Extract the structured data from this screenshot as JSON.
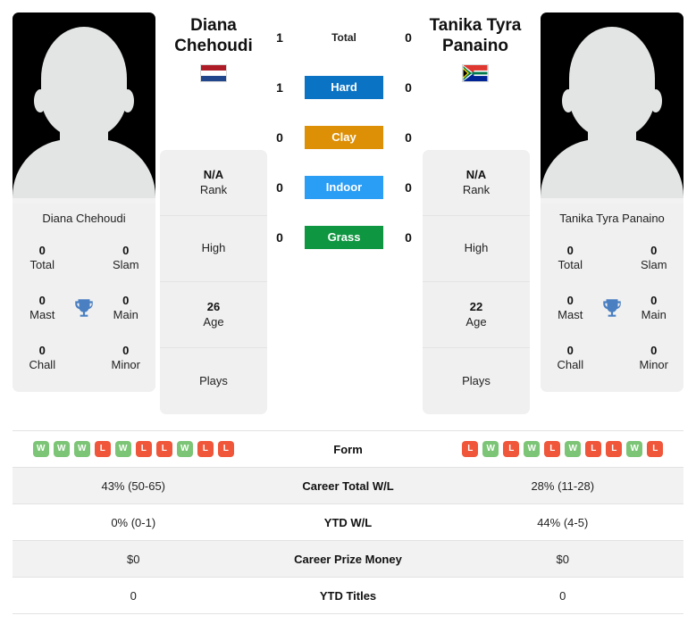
{
  "players": {
    "left": {
      "name": "Diana Chehoudi",
      "name_line1": "Diana",
      "name_line2": "Chehoudi",
      "flag": "netherlands-flag",
      "rank": "N/A",
      "rank_label": "Rank",
      "high_label": "High",
      "high_value": "",
      "age": "26",
      "age_label": "Age",
      "plays_label": "Plays",
      "plays_value": "",
      "titles": {
        "total": "0",
        "total_label": "Total",
        "slam": "0",
        "slam_label": "Slam",
        "mast": "0",
        "mast_label": "Mast",
        "main": "0",
        "main_label": "Main",
        "chall": "0",
        "chall_label": "Chall",
        "minor": "0",
        "minor_label": "Minor"
      },
      "form": [
        "W",
        "W",
        "W",
        "L",
        "W",
        "L",
        "L",
        "W",
        "L",
        "L"
      ],
      "career_total_wl": "43% (50-65)",
      "ytd_wl": "0% (0-1)",
      "career_prize_money": "$0",
      "ytd_titles": "0"
    },
    "right": {
      "name": "Tanika Tyra Panaino",
      "name_line1": "Tanika Tyra",
      "name_line2": "Panaino",
      "flag": "south-africa-flag",
      "rank": "N/A",
      "rank_label": "Rank",
      "high_label": "High",
      "high_value": "",
      "age": "22",
      "age_label": "Age",
      "plays_label": "Plays",
      "plays_value": "",
      "titles": {
        "total": "0",
        "total_label": "Total",
        "slam": "0",
        "slam_label": "Slam",
        "mast": "0",
        "mast_label": "Mast",
        "main": "0",
        "main_label": "Main",
        "chall": "0",
        "chall_label": "Chall",
        "minor": "0",
        "minor_label": "Minor"
      },
      "form": [
        "L",
        "W",
        "L",
        "W",
        "L",
        "W",
        "L",
        "L",
        "W",
        "L"
      ],
      "career_total_wl": "28% (11-28)",
      "ytd_wl": "44% (4-5)",
      "career_prize_money": "$0",
      "ytd_titles": "0"
    }
  },
  "h2h": [
    {
      "label": "Total",
      "left": "1",
      "right": "0",
      "color": "",
      "style": "plain"
    },
    {
      "label": "Hard",
      "left": "1",
      "right": "0",
      "color": "#0b73c3",
      "style": "badge"
    },
    {
      "label": "Clay",
      "left": "0",
      "right": "0",
      "color": "#dd9006",
      "style": "badge"
    },
    {
      "label": "Indoor",
      "left": "0",
      "right": "0",
      "color": "#2a9df4",
      "style": "badge"
    },
    {
      "label": "Grass",
      "left": "0",
      "right": "0",
      "color": "#0e9640",
      "style": "badge"
    }
  ],
  "stats_rows": [
    {
      "label": "Form",
      "type": "form"
    },
    {
      "label": "Career Total W/L",
      "type": "text",
      "key": "career_total_wl"
    },
    {
      "label": "YTD W/L",
      "type": "text",
      "key": "ytd_wl"
    },
    {
      "label": "Career Prize Money",
      "type": "text",
      "key": "career_prize_money"
    },
    {
      "label": "YTD Titles",
      "type": "text",
      "key": "ytd_titles"
    }
  ],
  "colors": {
    "win": "#7cc576",
    "loss": "#f0563a",
    "trophy": "#4a7fc1",
    "card_bg": "#f0f0f0",
    "row_shaded": "#f2f2f2"
  }
}
